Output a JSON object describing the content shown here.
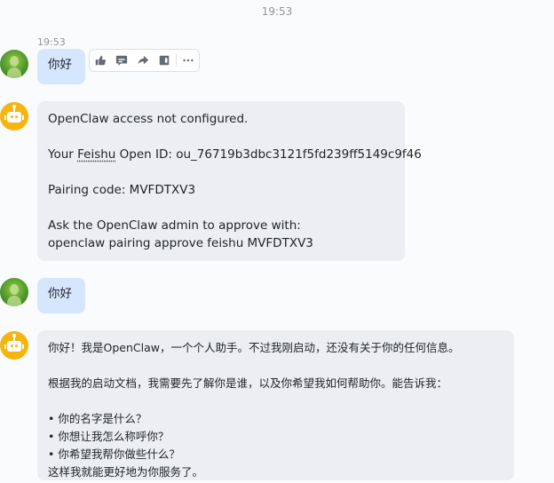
{
  "header": {
    "time": "19:53"
  },
  "messages": [
    {
      "sender": "user",
      "time": "19:53",
      "text": "你好"
    },
    {
      "sender": "bot",
      "lines": [
        "OpenClaw access not configured.",
        "",
        "Your Feishu Open ID: ou_76719b3dbc3121f5fd239ff5149c9f46",
        "",
        "Pairing code: MVFDTXV3",
        "",
        "Ask the OpenClaw admin to approve with:",
        "openclaw pairing approve feishu MVFDTXV3"
      ],
      "open_id_prefix": "Your ",
      "open_id_word": "Feishu",
      "open_id_suffix": " Open ID: ou_76719b3dbc3121f5fd239ff5149c9f46"
    },
    {
      "sender": "user",
      "text": "你好"
    },
    {
      "sender": "bot",
      "lines": [
        "你好！我是OpenClaw，一个个人助手。不过我刚启动，还没有关于你的任何信息。",
        "",
        "根据我的启动文档，我需要先了解你是谁，以及你希望我如何帮助你。能告诉我：",
        "",
        "• 你的名字是什么？",
        "• 你想让我怎么称呼你？",
        "• 你希望我帮你做些什么？",
        "这样我就能更好地为你服务了。"
      ]
    }
  ],
  "actions": [
    {
      "name": "like-icon"
    },
    {
      "name": "reply-icon"
    },
    {
      "name": "forward-icon"
    },
    {
      "name": "quote-icon"
    },
    {
      "name": "more-icon"
    }
  ],
  "colors": {
    "user_bubble": "#d6e6fe",
    "bot_bubble": "#eceef1",
    "bot_avatar": "#f5b50f",
    "background": "#fafbfc"
  }
}
